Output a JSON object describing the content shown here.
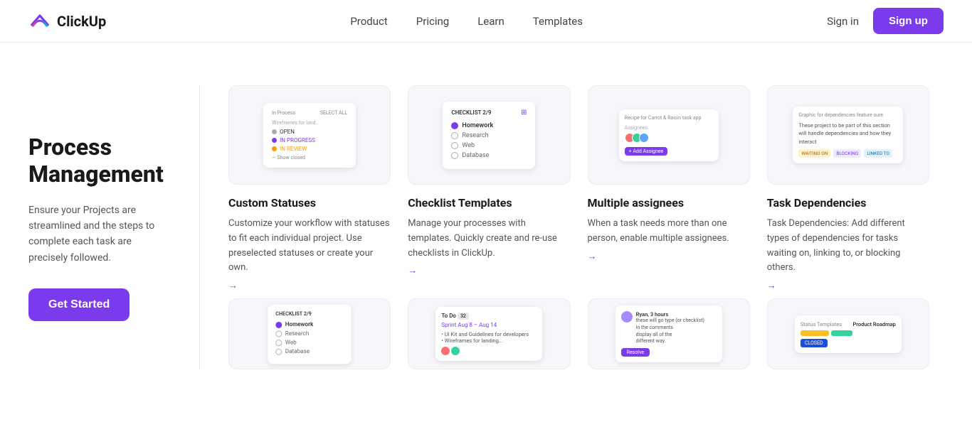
{
  "nav": {
    "logo_text": "ClickUp",
    "links": [
      {
        "label": "Product",
        "id": "product"
      },
      {
        "label": "Pricing",
        "id": "pricing"
      },
      {
        "label": "Learn",
        "id": "learn"
      },
      {
        "label": "Templates",
        "id": "templates"
      }
    ],
    "sign_in": "Sign in",
    "sign_up": "Sign up"
  },
  "sidebar": {
    "title": "Process Management",
    "description": "Ensure your Projects are streamlined and the steps to complete each task are precisely followed.",
    "cta": "Get Started"
  },
  "features": [
    {
      "id": "custom-statuses",
      "title": "Custom Statuses",
      "description": "Customize your workflow with statuses to fit each individual project. Use preselected statuses or create your own.",
      "link_text": "→",
      "type": "statuses"
    },
    {
      "id": "checklist-templates",
      "title": "Checklist Templates",
      "description": "Manage your processes with templates. Quickly create and re-use checklists in ClickUp.",
      "link_text": "→",
      "type": "checklist"
    },
    {
      "id": "multiple-assignees",
      "title": "Multiple assignees",
      "description": "When a task needs more than one person, enable multiple assignees.",
      "link_text": "→",
      "type": "assignees"
    },
    {
      "id": "task-dependencies",
      "title": "Task Dependencies",
      "description": "Task Dependencies: Add different types of dependencies for tasks waiting on, linking to, or blocking others.",
      "link_text": "→",
      "type": "dependencies"
    }
  ],
  "bottom_features": [
    {
      "id": "checklist2",
      "type": "checklist"
    },
    {
      "id": "sprint",
      "type": "sprint"
    },
    {
      "id": "comments",
      "type": "comments"
    },
    {
      "id": "roadmap",
      "type": "roadmap"
    }
  ],
  "mock": {
    "checklist_header": "CHECKLIST 2/9",
    "checklist_items": [
      "Homework",
      "Research",
      "Web",
      "Database"
    ],
    "status_items": [
      "OPEN",
      "IN PROGRESS",
      "IN REVIEW",
      "Show closed"
    ],
    "assignee_label": "Assignees"
  }
}
